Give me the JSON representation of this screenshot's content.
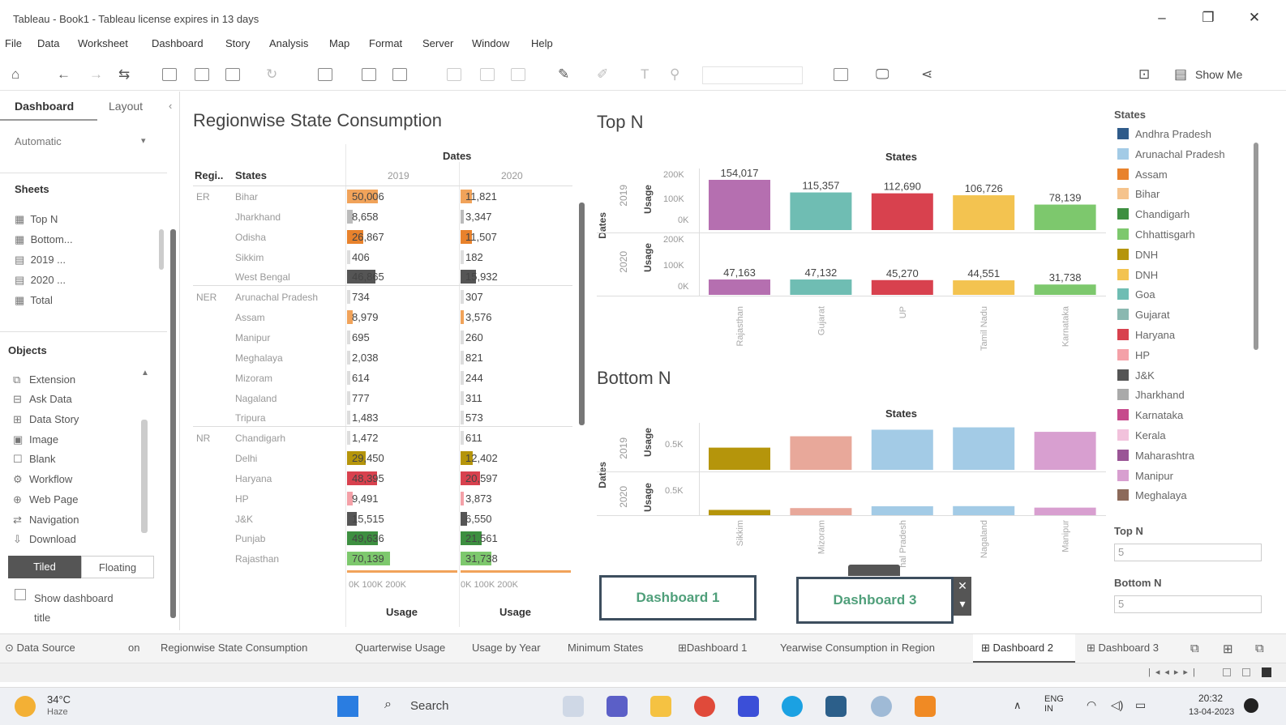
{
  "window": {
    "title": "Tableau - Book1 - Tableau license expires in 13 days",
    "min": "–",
    "max": "❐",
    "close": "✕"
  },
  "menu": [
    "File",
    "Data",
    "Worksheet",
    "Dashboard",
    "Story",
    "Analysis",
    "Map",
    "Format",
    "Server",
    "Window",
    "Help"
  ],
  "toolbar": {
    "show_me": "Show Me"
  },
  "left": {
    "tab_dashboard": "Dashboard",
    "tab_layout": "Layout",
    "size": "Automatic",
    "sheets_title": "Sheets",
    "sheets": [
      "Top N",
      "Bottom...",
      "2019 ...",
      "2020 ...",
      "Total"
    ],
    "objects_title": "Objects",
    "objects": [
      "Extension",
      "Ask Data",
      "Data Story",
      "Image",
      "Blank",
      "Workflow",
      "Web Page",
      "Navigation",
      "Download"
    ],
    "tiled": "Tiled",
    "floating": "Floating",
    "show_title": "Show dashboard title"
  },
  "regional": {
    "title": "Regionwise State Consumption",
    "dates_header": "Dates",
    "region_col": "Regi..",
    "states_col": "States",
    "years": [
      "2019",
      "2020"
    ],
    "rows": [
      {
        "region": "ER",
        "state": "Bihar",
        "v2019": "50,006",
        "v2020": "11,821",
        "c2019": "#f1a35a",
        "c2020": "#f1a35a",
        "f2019": 0.28,
        "f2020": 0.1
      },
      {
        "region": "",
        "state": "Jharkhand",
        "v2019": "8,658",
        "v2020": "3,347",
        "c2019": "#bbbbbb",
        "c2020": "#bbbbbb",
        "f2019": 0.05,
        "f2020": 0.03
      },
      {
        "region": "",
        "state": "Odisha",
        "v2019": "26,867",
        "v2020": "11,507",
        "c2019": "#e8822c",
        "c2020": "#e8822c",
        "f2019": 0.15,
        "f2020": 0.1
      },
      {
        "region": "",
        "state": "Sikkim",
        "v2019": "406",
        "v2020": "182",
        "c2019": "#dddddd",
        "c2020": "#dddddd",
        "f2019": 0.01,
        "f2020": 0.01
      },
      {
        "region": "",
        "state": "West Bengal",
        "v2019": "46,865",
        "v2020": "15,932",
        "c2019": "#555555",
        "c2020": "#555555",
        "f2019": 0.26,
        "f2020": 0.14
      },
      {
        "region": "NER",
        "state": "Arunachal Pradesh",
        "v2019": "734",
        "v2020": "307",
        "c2019": "#dddddd",
        "c2020": "#dddddd",
        "f2019": 0.01,
        "f2020": 0.01
      },
      {
        "region": "",
        "state": "Assam",
        "v2019": "8,979",
        "v2020": "3,576",
        "c2019": "#f1a35a",
        "c2020": "#f1a35a",
        "f2019": 0.05,
        "f2020": 0.03
      },
      {
        "region": "",
        "state": "Manipur",
        "v2019": "695",
        "v2020": "260",
        "c2019": "#dddddd",
        "c2020": "#dddddd",
        "f2019": 0.01,
        "f2020": 0.01
      },
      {
        "region": "",
        "state": "Meghalaya",
        "v2019": "2,038",
        "v2020": "821",
        "c2019": "#dddddd",
        "c2020": "#dddddd",
        "f2019": 0.01,
        "f2020": 0.01
      },
      {
        "region": "",
        "state": "Mizoram",
        "v2019": "614",
        "v2020": "244",
        "c2019": "#dddddd",
        "c2020": "#dddddd",
        "f2019": 0.01,
        "f2020": 0.01
      },
      {
        "region": "",
        "state": "Nagaland",
        "v2019": "777",
        "v2020": "311",
        "c2019": "#dddddd",
        "c2020": "#dddddd",
        "f2019": 0.01,
        "f2020": 0.01
      },
      {
        "region": "",
        "state": "Tripura",
        "v2019": "1,483",
        "v2020": "573",
        "c2019": "#dddddd",
        "c2020": "#dddddd",
        "f2019": 0.01,
        "f2020": 0.01
      },
      {
        "region": "NR",
        "state": "Chandigarh",
        "v2019": "1,472",
        "v2020": "611",
        "c2019": "#dddddd",
        "c2020": "#dddddd",
        "f2019": 0.01,
        "f2020": 0.01
      },
      {
        "region": "",
        "state": "Delhi",
        "v2019": "29,450",
        "v2020": "12,402",
        "c2019": "#b5950b",
        "c2020": "#b5950b",
        "f2019": 0.17,
        "f2020": 0.11
      },
      {
        "region": "",
        "state": "Haryana",
        "v2019": "48,395",
        "v2020": "20,597",
        "c2019": "#d8414e",
        "c2020": "#d8414e",
        "f2019": 0.27,
        "f2020": 0.18
      },
      {
        "region": "",
        "state": "HP",
        "v2019": "9,491",
        "v2020": "3,873",
        "c2019": "#f4a1a8",
        "c2020": "#f4a1a8",
        "f2019": 0.05,
        "f2020": 0.03
      },
      {
        "region": "",
        "state": "J&K",
        "v2019": "15,515",
        "v2020": "6,550",
        "c2019": "#555555",
        "c2020": "#555555",
        "f2019": 0.09,
        "f2020": 0.06
      },
      {
        "region": "",
        "state": "Punjab",
        "v2019": "49,636",
        "v2020": "21,561",
        "c2019": "#3d8f40",
        "c2020": "#3d8f40",
        "f2019": 0.28,
        "f2020": 0.19
      },
      {
        "region": "",
        "state": "Rajasthan",
        "v2019": "70,139",
        "v2020": "31,738",
        "c2019": "#7dc86d",
        "c2020": "#7dc86d",
        "f2019": 0.39,
        "f2020": 0.28
      }
    ],
    "axis_labels": [
      "0K 100K 200K",
      "0K 100K 200K"
    ],
    "usage_label": "Usage"
  },
  "topn": {
    "title": "Top N",
    "states_header": "States",
    "dates_label": "Dates",
    "usage_label": "Usage",
    "row_years": [
      "2019",
      "2020"
    ],
    "ticks_top": [
      "200K",
      "100K",
      "0K"
    ],
    "ticks_bot": [
      "200K",
      "100K",
      "0K"
    ],
    "chart_data": {
      "type": "bar",
      "categories": [
        "Rajasthan",
        "Gujarat",
        "UP",
        "Tamil Nadu",
        "Karnataka"
      ],
      "colors": [
        "#b56fb0",
        "#6fbdb3",
        "#d8414e",
        "#f3c350",
        "#7dc86d"
      ],
      "series": [
        {
          "name": "2019",
          "values": [
            154017,
            115357,
            112690,
            106726,
            78139
          ],
          "labels": [
            "154,017",
            "115,357",
            "112,690",
            "106,726",
            "78,139"
          ]
        },
        {
          "name": "2020",
          "values": [
            47163,
            47132,
            45270,
            44551,
            31738
          ],
          "labels": [
            "47,163",
            "47,132",
            "45,270",
            "44,551",
            "31,738"
          ]
        }
      ],
      "ylim": [
        0,
        200000
      ]
    }
  },
  "bottomn": {
    "title": "Bottom N",
    "states_header": "States",
    "dates_label": "Dates",
    "usage_label": "Usage",
    "row_years": [
      "2019",
      "2020"
    ],
    "tick": "0.5K",
    "chart_data": {
      "type": "bar",
      "categories": [
        "Sikkim",
        "Mizoram",
        "Arunachal Pradesh",
        "Nagaland",
        "Manipur"
      ],
      "colors": [
        "#b5950b",
        "#e8a89a",
        "#a3cbe6",
        "#a3cbe6",
        "#d89fd0"
      ],
      "series": [
        {
          "name": "2019",
          "values": [
            406,
            614,
            734,
            777,
            695
          ]
        },
        {
          "name": "2020",
          "values": [
            182,
            244,
            307,
            311,
            260
          ]
        }
      ],
      "ylim": [
        0,
        800
      ]
    }
  },
  "legend": {
    "title": "States",
    "items": [
      {
        "label": "Andhra Pradesh",
        "color": "#2f5b8a"
      },
      {
        "label": "Arunachal Pradesh",
        "color": "#a3cbe6"
      },
      {
        "label": "Assam",
        "color": "#e8822c"
      },
      {
        "label": "Bihar",
        "color": "#f5c38c"
      },
      {
        "label": "Chandigarh",
        "color": "#3d8f40"
      },
      {
        "label": "Chhattisgarh",
        "color": "#7dc86d"
      },
      {
        "label": "DNH",
        "color": "#b5950b"
      },
      {
        "label": "DNH",
        "color": "#f3c350"
      },
      {
        "label": "Goa",
        "color": "#6fbdb3"
      },
      {
        "label": "Gujarat",
        "color": "#8ab8b0"
      },
      {
        "label": "Haryana",
        "color": "#d8414e"
      },
      {
        "label": "HP",
        "color": "#f4a1a8"
      },
      {
        "label": "J&K",
        "color": "#555555"
      },
      {
        "label": "Jharkhand",
        "color": "#aaaaaa"
      },
      {
        "label": "Karnataka",
        "color": "#c64a8c"
      },
      {
        "label": "Kerala",
        "color": "#f2c2dc"
      },
      {
        "label": "Maharashtra",
        "color": "#9a5596"
      },
      {
        "label": "Manipur",
        "color": "#d89fd0"
      },
      {
        "label": "Meghalaya",
        "color": "#8c6a5a"
      }
    ]
  },
  "params": {
    "topn_label": "Top N",
    "topn_value": "5",
    "bottomn_label": "Bottom N",
    "bottomn_value": "5"
  },
  "buttons": {
    "dash1": "Dashboard 1",
    "dash3": "Dashboard 3"
  },
  "tabs": [
    "Data Source",
    "on",
    "Regionwise State Consumption",
    "Quarterwise Usage",
    "Usage by Year",
    "Minimum States",
    "Dashboard 1",
    "Yearwise Consumption in Region",
    "Dashboard 2",
    "Dashboard 3"
  ],
  "taskbar": {
    "temp": "34°C",
    "weather": "Haze",
    "search": "Search",
    "lang": "ENG IN",
    "time": "20:32",
    "date": "13-04-2023"
  }
}
